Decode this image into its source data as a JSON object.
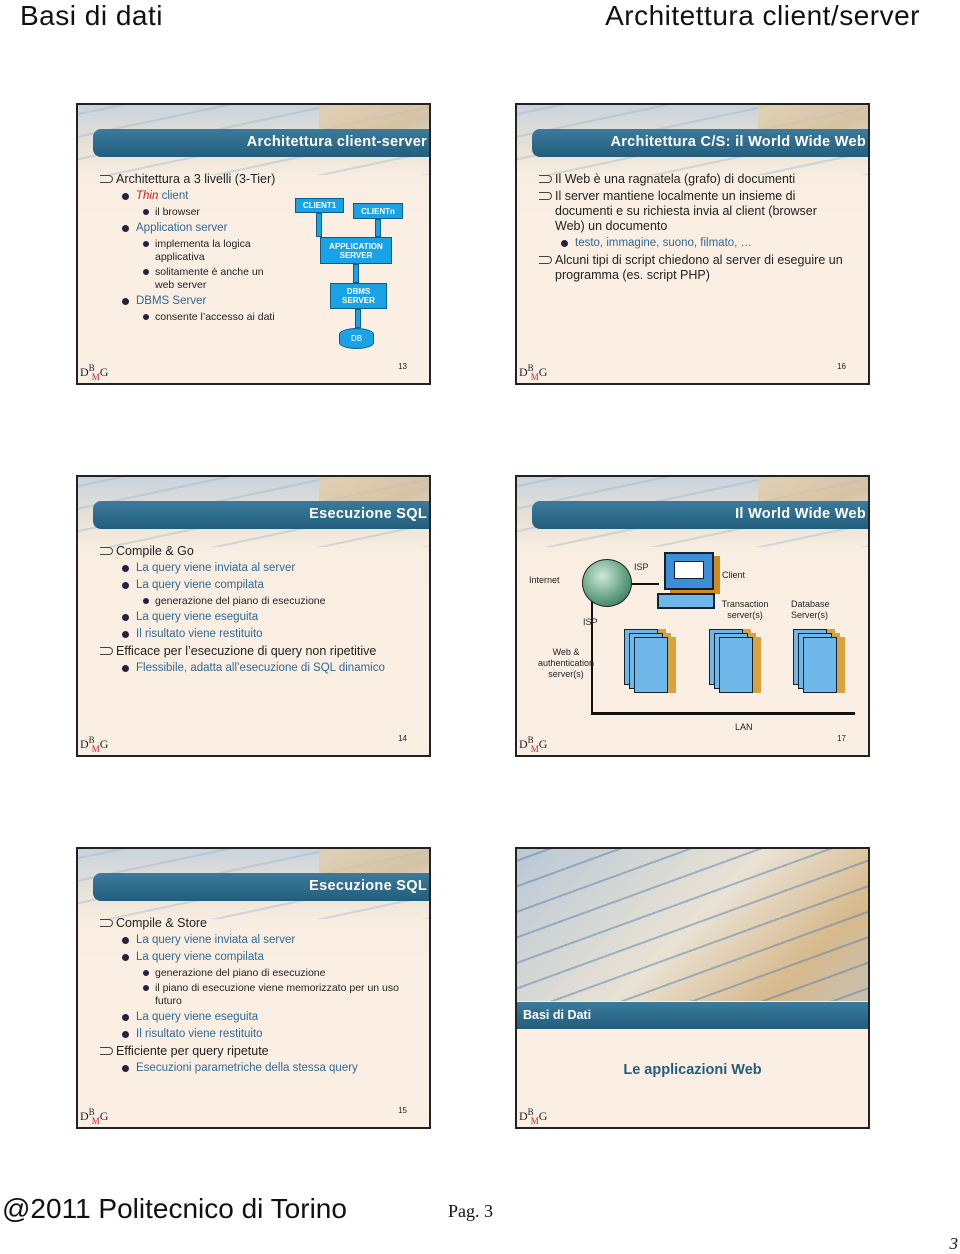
{
  "page": {
    "title_left": "Basi di dati",
    "title_right": "Architettura client/server",
    "footer_left": "@2011 Politecnico di Torino",
    "footer_page": "Pag. 3",
    "corner_number": "3"
  },
  "logo": "DBMG",
  "slides": [
    {
      "title": "Architettura client-server",
      "number": "13",
      "bullets": [
        {
          "level": 1,
          "text": "Architettura a 3 livelli (3-Tier)"
        },
        {
          "level": 2,
          "em": "Thin",
          "text": " client"
        },
        {
          "level": 3,
          "text": "il browser"
        },
        {
          "level": 2,
          "text": "Application server"
        },
        {
          "level": 3,
          "text": "implementa la logica applicativa"
        },
        {
          "level": 3,
          "text": "solitamente è anche un web server"
        },
        {
          "level": 2,
          "text": "DBMS Server"
        },
        {
          "level": 3,
          "text": "consente l’accesso ai dati"
        }
      ],
      "diagram": {
        "client1": "CLIENT1",
        "clientn": "CLIENTn",
        "app": "APPLICATION SERVER",
        "dbms": "DBMS SERVER",
        "db": "DB"
      }
    },
    {
      "title": "Architettura C/S: il World Wide Web",
      "number": "16",
      "bullets": [
        {
          "level": 1,
          "text": "Il Web è una ragnatela (grafo) di documenti"
        },
        {
          "level": 1,
          "text": "Il server mantiene localmente un insieme di documenti e su richiesta invia al client (browser Web) un documento"
        },
        {
          "level": 2,
          "text": "testo, immagine, suono, filmato, …"
        },
        {
          "level": 1,
          "text": "Alcuni tipi di script chiedono al server di eseguire un programma (es. script PHP)"
        }
      ]
    },
    {
      "title": "Esecuzione SQL",
      "number": "14",
      "bullets": [
        {
          "level": 1,
          "text": "Compile & Go"
        },
        {
          "level": 2,
          "text": "La query viene inviata al server"
        },
        {
          "level": 2,
          "text": "La query viene compilata"
        },
        {
          "level": 3,
          "text": "generazione del piano di esecuzione"
        },
        {
          "level": 2,
          "text": "La query viene eseguita"
        },
        {
          "level": 2,
          "text": "Il risultato viene restituito"
        },
        {
          "level": 1,
          "text": "Efficace per l’esecuzione di query non ripetitive"
        },
        {
          "level": 2,
          "text": "Flessibile, adatta all’esecuzione di SQL dinamico"
        }
      ]
    },
    {
      "title": "Il World Wide Web",
      "number": "17",
      "diagram": {
        "internet": "Internet",
        "isp_top": "ISP",
        "client": "Client",
        "isp_left": "ISP",
        "transaction": "Transaction server(s)",
        "database": "Database Server(s)",
        "web": "Web & authentication server(s)",
        "lan": "LAN"
      }
    },
    {
      "title": "Esecuzione SQL",
      "number": "15",
      "bullets": [
        {
          "level": 1,
          "text": "Compile & Store"
        },
        {
          "level": 2,
          "text": "La query viene inviata al server"
        },
        {
          "level": 2,
          "text": "La query viene compilata"
        },
        {
          "level": 3,
          "text": "generazione del piano di esecuzione"
        },
        {
          "level": 3,
          "text": "il piano di esecuzione viene memorizzato per un uso futuro"
        },
        {
          "level": 2,
          "text": "La query viene eseguita"
        },
        {
          "level": 2,
          "text": "Il risultato viene restituito"
        },
        {
          "level": 1,
          "text": "Efficiente per query ripetute"
        },
        {
          "level": 2,
          "text": "Esecuzioni parametriche della stessa query"
        }
      ]
    },
    {
      "section": "Basi di Dati",
      "subtitle": "Le applicazioni Web"
    }
  ]
}
